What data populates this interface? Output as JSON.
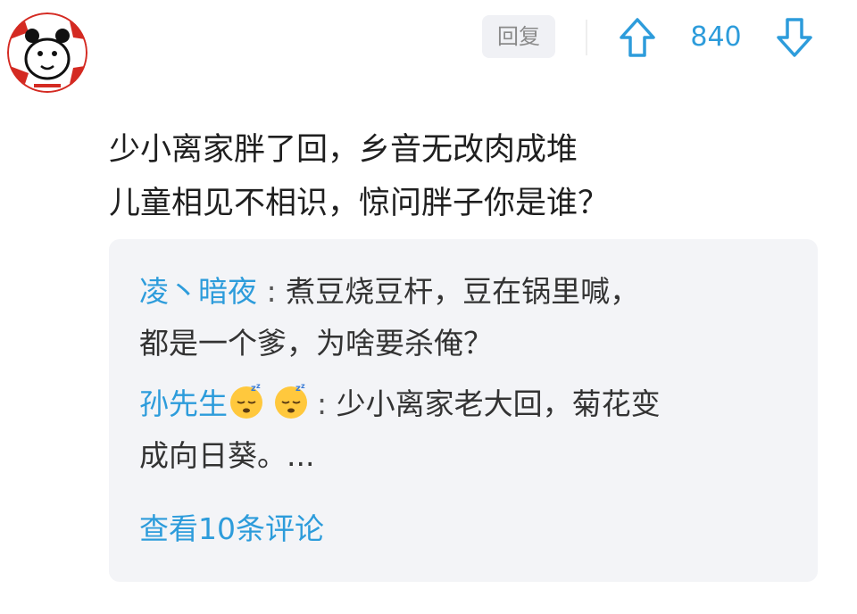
{
  "comment": {
    "reply_label": "回复",
    "vote_count": "840",
    "icons": {
      "upvote": "arrow-up-icon",
      "downvote": "arrow-down-icon",
      "avatar": "panda-avatar"
    },
    "body_lines": [
      "少小离家胖了回，乡音无改肉成堆",
      "儿童相见不相识，惊问胖子你是谁？"
    ]
  },
  "replies": [
    {
      "author": "凌丶暗夜",
      "separator": ":",
      "lines": [
        "煮豆烧豆杆，豆在锅里喊，",
        "都是一个爹，为啥要杀俺？"
      ]
    },
    {
      "author": "孙先生",
      "emojis": [
        "sleeping-face-emoji",
        "sleeping-face-emoji"
      ],
      "separator": ":",
      "lines": [
        "少小离家老大回，菊花变",
        "成向日葵。..."
      ]
    }
  ],
  "view_more_label": "查看10条评论",
  "colors": {
    "accent_blue": "#2d9cdb",
    "reply_bg": "#f3f4f7",
    "avatar_red": "#d42a22"
  }
}
